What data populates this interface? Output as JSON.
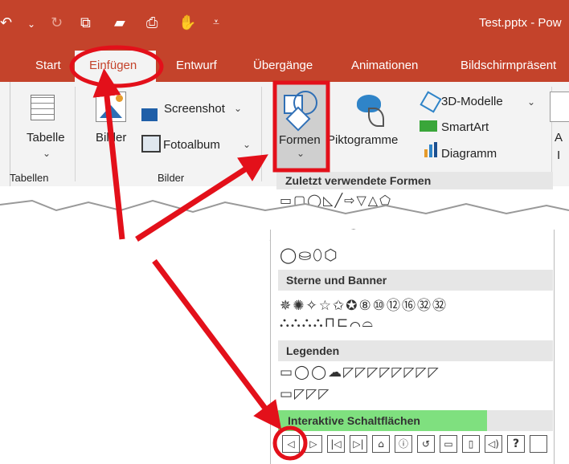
{
  "titlebar": {
    "file_title": "Test.pptx  -  Pow",
    "qat_icons": [
      "undo-icon",
      "redo-icon",
      "slideshow-icon",
      "open-folder-icon",
      "print-preview-icon",
      "touch-mode-icon",
      "customize-qat-icon"
    ]
  },
  "tabs": [
    {
      "label": "Start"
    },
    {
      "label": "Einfügen"
    },
    {
      "label": "Entwurf"
    },
    {
      "label": "Übergänge"
    },
    {
      "label": "Animationen"
    },
    {
      "label": "Bildschirmpräsent"
    }
  ],
  "ribbon": {
    "tabelle": "Tabelle",
    "tabellen_group": "Tabellen",
    "bilder_btn": "Bilder",
    "screenshot": "Screenshot",
    "fotoalbum": "Fotoalbum",
    "bilder_group": "Bilder",
    "formen": "Formen",
    "piktogramme": "Piktogramme",
    "modelle": "3D-Modelle",
    "smartart": "SmartArt",
    "diagramm": "Diagramm",
    "cut_a": "A",
    "cut_i": "I"
  },
  "shapes_menu": {
    "recent": "Zuletzt verwendete Formen",
    "stars": "Sterne und Banner",
    "callouts": "Legenden",
    "action_buttons": "Interaktive Schaltflächen",
    "action_button_glyphs": [
      "◁",
      "▷",
      "|◁",
      "▷|",
      "⌂",
      "ⓘ",
      "↺",
      "▭",
      "▯",
      "◁)",
      "?",
      ""
    ]
  },
  "colors": {
    "accent": "#c4432b",
    "highlight": "#7fe07f",
    "annotation": "#e3101a"
  }
}
